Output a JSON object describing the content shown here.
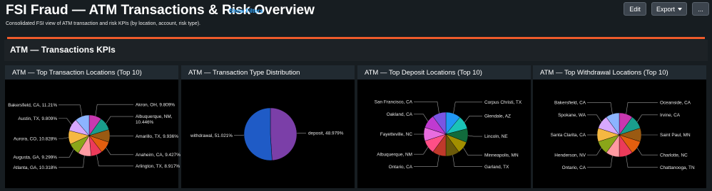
{
  "dashboard": {
    "title": "FSI Fraud — ATM Transactions & Risk Overview",
    "show_filters": "Show Filters",
    "subtitle": "Consolidated FSI view of ATM transaction and risk KPIs (by location, account, risk type).",
    "buttons": {
      "edit": "Edit",
      "export": "Export",
      "more": "..."
    },
    "accent_color": "#ef5b2b"
  },
  "section": {
    "title": "ATM — Transactions KPIs"
  },
  "panels": [
    {
      "title": "ATM — Top Transaction Locations (Top 10)"
    },
    {
      "title": "ATM — Transaction Type Distribution"
    },
    {
      "title": "ATM — Top Deposit Locations (Top 10)"
    },
    {
      "title": "ATM — Top Withdrawal Locations (Top 10)"
    }
  ],
  "chart_data": [
    {
      "type": "pie",
      "title": "ATM — Top Transaction Locations (Top 10)",
      "slices": [
        {
          "label": "Akron, OH, 9.809%",
          "value": 9.809,
          "color": "#c838b0"
        },
        {
          "label": "Albuquerque, NM, 10.446%",
          "value": 10.446,
          "color": "#1a9d8c"
        },
        {
          "label": "Amarillo, TX, 9.936%",
          "value": 9.936,
          "color": "#9a5a12"
        },
        {
          "label": "Anaheim, CA, 9.427%",
          "value": 9.427,
          "color": "#e35f0f"
        },
        {
          "label": "Arlington, TX, 8.917%",
          "value": 8.917,
          "color": "#ec3b5a"
        },
        {
          "label": "Atlanta, GA, 10.318%",
          "value": 10.318,
          "color": "#ff9aa2"
        },
        {
          "label": "Augusta, GA, 9.299%",
          "value": 9.299,
          "color": "#8aa619"
        },
        {
          "label": "Aurora, CO, 10.828%",
          "value": 10.828,
          "color": "#f5b842"
        },
        {
          "label": "Austin, TX, 9.809%",
          "value": 9.809,
          "color": "#d7a8ff"
        },
        {
          "label": "Bakersfield, CA, 11.21%",
          "value": 11.21,
          "color": "#8cb4ff"
        }
      ]
    },
    {
      "type": "pie",
      "title": "ATM — Transaction Type Distribution",
      "slices": [
        {
          "label": "deposit, 48.979%",
          "value": 48.979,
          "color": "#7b3fa8"
        },
        {
          "label": "withdrawal, 51.021%",
          "value": 51.021,
          "color": "#1f5bc6"
        }
      ]
    },
    {
      "type": "pie",
      "title": "ATM — Top Deposit Locations (Top 10)",
      "slices": [
        {
          "label": "Corpus Christi, TX",
          "value": 11,
          "color": "#2196f3"
        },
        {
          "label": "Glendale, AZ",
          "value": 10,
          "color": "#1bc3b8"
        },
        {
          "label": "Lincoln, NE",
          "value": 10,
          "color": "#116b3c"
        },
        {
          "label": "Minneapolis, MN",
          "value": 9,
          "color": "#a28e00"
        },
        {
          "label": "Garland, TX",
          "value": 10,
          "color": "#6b5a0a"
        },
        {
          "label": "Ontario, CA",
          "value": 10,
          "color": "#c0392b"
        },
        {
          "label": "Albuquerque, NM",
          "value": 10,
          "color": "#ff4f87"
        },
        {
          "label": "Fayetteville, NC",
          "value": 10,
          "color": "#e86ddf"
        },
        {
          "label": "Oakland, CA",
          "value": 10,
          "color": "#c03ad1"
        },
        {
          "label": "San Francisco, CA",
          "value": 10,
          "color": "#7a55e3"
        }
      ]
    },
    {
      "type": "pie",
      "title": "ATM — Top Withdrawal Locations (Top 10)",
      "slices": [
        {
          "label": "Oceanside, CA",
          "value": 10,
          "color": "#c838b0"
        },
        {
          "label": "Irvine, CA",
          "value": 10,
          "color": "#1a9d8c"
        },
        {
          "label": "Saint Paul, MN",
          "value": 10,
          "color": "#9a5a12"
        },
        {
          "label": "Charlotte, NC",
          "value": 10,
          "color": "#e35f0f"
        },
        {
          "label": "Chattanooga, TN",
          "value": 10,
          "color": "#ec3b5a"
        },
        {
          "label": "Ontario, CA",
          "value": 10,
          "color": "#ff9aa2"
        },
        {
          "label": "Henderson, NV",
          "value": 10,
          "color": "#8aa619"
        },
        {
          "label": "Santa Clarita, CA",
          "value": 10,
          "color": "#f5b842"
        },
        {
          "label": "Spokane, WA",
          "value": 10,
          "color": "#d7a8ff"
        },
        {
          "label": "Bakersfield, CA",
          "value": 10,
          "color": "#8cb4ff"
        }
      ]
    }
  ]
}
